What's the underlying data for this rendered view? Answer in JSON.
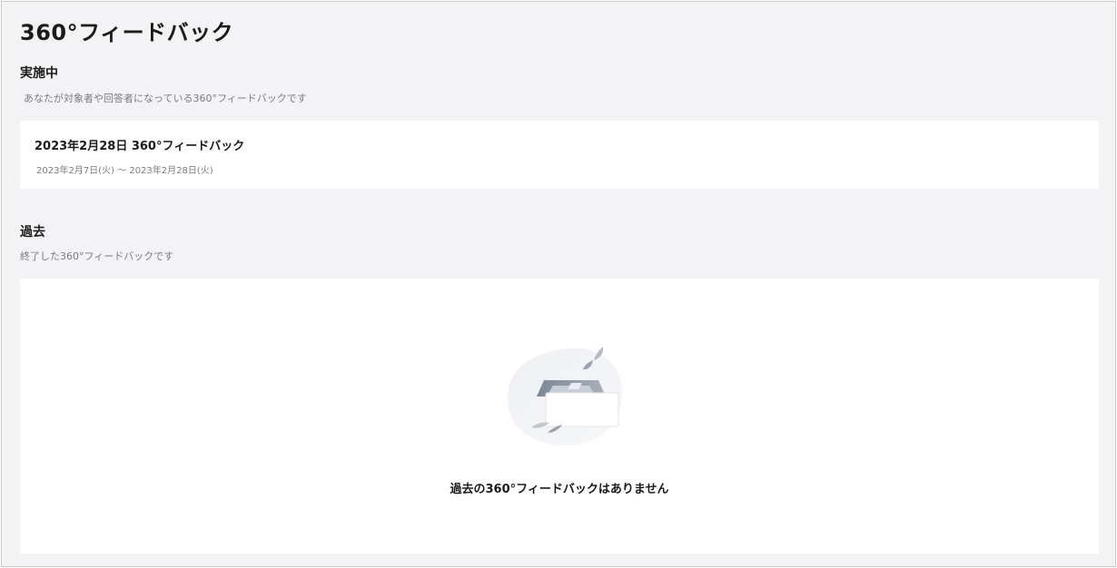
{
  "page": {
    "title": "360°フィードバック"
  },
  "active": {
    "heading": "実施中",
    "description": "あなたが対象者や回答者になっている360°フィードバックです",
    "items": [
      {
        "title": "2023年2月28日 360°フィードバック",
        "period": "2023年2月7日(火) 〜 2023年2月28日(火)"
      }
    ]
  },
  "past": {
    "heading": "過去",
    "description": "終了した360°フィードバックです",
    "empty_message": "過去の360°フィードバックはありません",
    "empty_icon": "empty-inbox-icon"
  },
  "colors": {
    "background": "#f3f3f5",
    "card": "#ffffff",
    "text_primary": "#1b1b1b",
    "text_secondary": "#7c7c80",
    "illustration": "#8e97a5"
  }
}
